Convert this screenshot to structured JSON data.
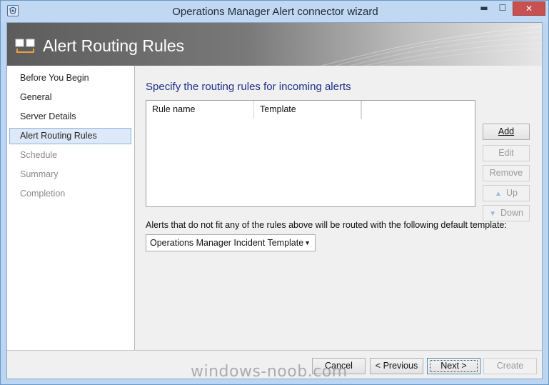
{
  "window": {
    "title": "Operations Manager Alert connector wizard",
    "controls": {
      "minimize": "▬",
      "maximize": "☐",
      "close": "✕"
    },
    "accent": "#c1d8f2"
  },
  "banner": {
    "title": "Alert Routing Rules",
    "icon": "wizard-pages-icon"
  },
  "steps": [
    {
      "label": "Before You Begin",
      "state": "done"
    },
    {
      "label": "General",
      "state": "done"
    },
    {
      "label": "Server Details",
      "state": "done"
    },
    {
      "label": "Alert Routing Rules",
      "state": "active"
    },
    {
      "label": "Schedule",
      "state": "disabled"
    },
    {
      "label": "Summary",
      "state": "disabled"
    },
    {
      "label": "Completion",
      "state": "disabled"
    }
  ],
  "main": {
    "heading": "Specify the routing rules for incoming alerts",
    "columns": [
      "Rule name",
      "Template",
      ""
    ],
    "rows": [],
    "buttons": {
      "add": "Add",
      "edit": "Edit",
      "remove": "Remove",
      "up": "Up",
      "down": "Down"
    },
    "default_note": "Alerts that do not fit any of the rules above will be routed with the following default template:",
    "default_template": "Operations Manager Incident Template"
  },
  "footer": {
    "cancel": "Cancel",
    "previous": "< Previous",
    "next": "Next >",
    "create": "Create"
  },
  "watermark": "windows-noob.com",
  "colors": {
    "heading": "#1c2d8a",
    "active_step_bg": "#dde9f8",
    "close_button": "#c75050"
  }
}
